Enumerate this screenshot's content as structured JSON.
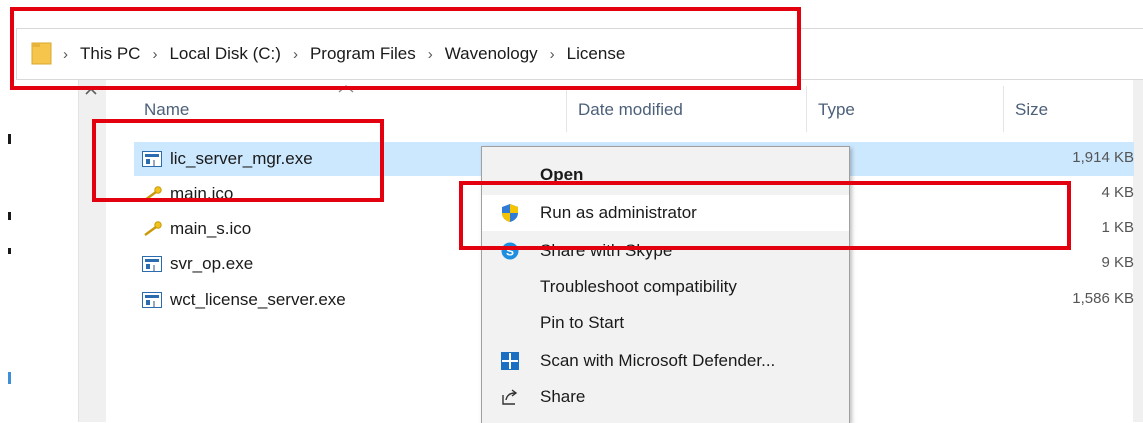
{
  "address_bar": {
    "breadcrumb": [
      "This PC",
      "Local Disk (C:)",
      "Program Files",
      "Wavenology",
      "License"
    ],
    "separator": "›"
  },
  "columns": {
    "name": "Name",
    "date_modified": "Date modified",
    "type": "Type",
    "size": "Size"
  },
  "files": [
    {
      "name": "lic_server_mgr.exe",
      "size": "1,914 KB",
      "icon": "exe-icon",
      "selected": true
    },
    {
      "name": "main.ico",
      "size": "4 KB",
      "icon": "key-icon",
      "selected": false
    },
    {
      "name": "main_s.ico",
      "size": "1 KB",
      "icon": "key-icon",
      "selected": false
    },
    {
      "name": "svr_op.exe",
      "size": "9 KB",
      "icon": "exe-icon",
      "selected": false
    },
    {
      "name": "wct_license_server.exe",
      "size": "1,586 KB",
      "icon": "exe-icon",
      "selected": false
    }
  ],
  "context_menu": {
    "items": [
      {
        "label": "Open",
        "icon": "",
        "bold": true
      },
      {
        "label": "Run as administrator",
        "icon": "uac-shield-icon",
        "highlighted": true
      },
      {
        "label": "Share with Skype",
        "icon": "skype-icon"
      },
      {
        "label": "Troubleshoot compatibility",
        "icon": ""
      },
      {
        "label": "Pin to Start",
        "icon": ""
      },
      {
        "label": "Scan with Microsoft Defender...",
        "icon": "defender-icon"
      },
      {
        "label": "Share",
        "icon": "share-icon"
      }
    ]
  },
  "colors": {
    "selection": "#cce8ff",
    "annotation": "#e3000f",
    "menu_background": "#f2f2f2",
    "folder": "#f5c64b"
  }
}
